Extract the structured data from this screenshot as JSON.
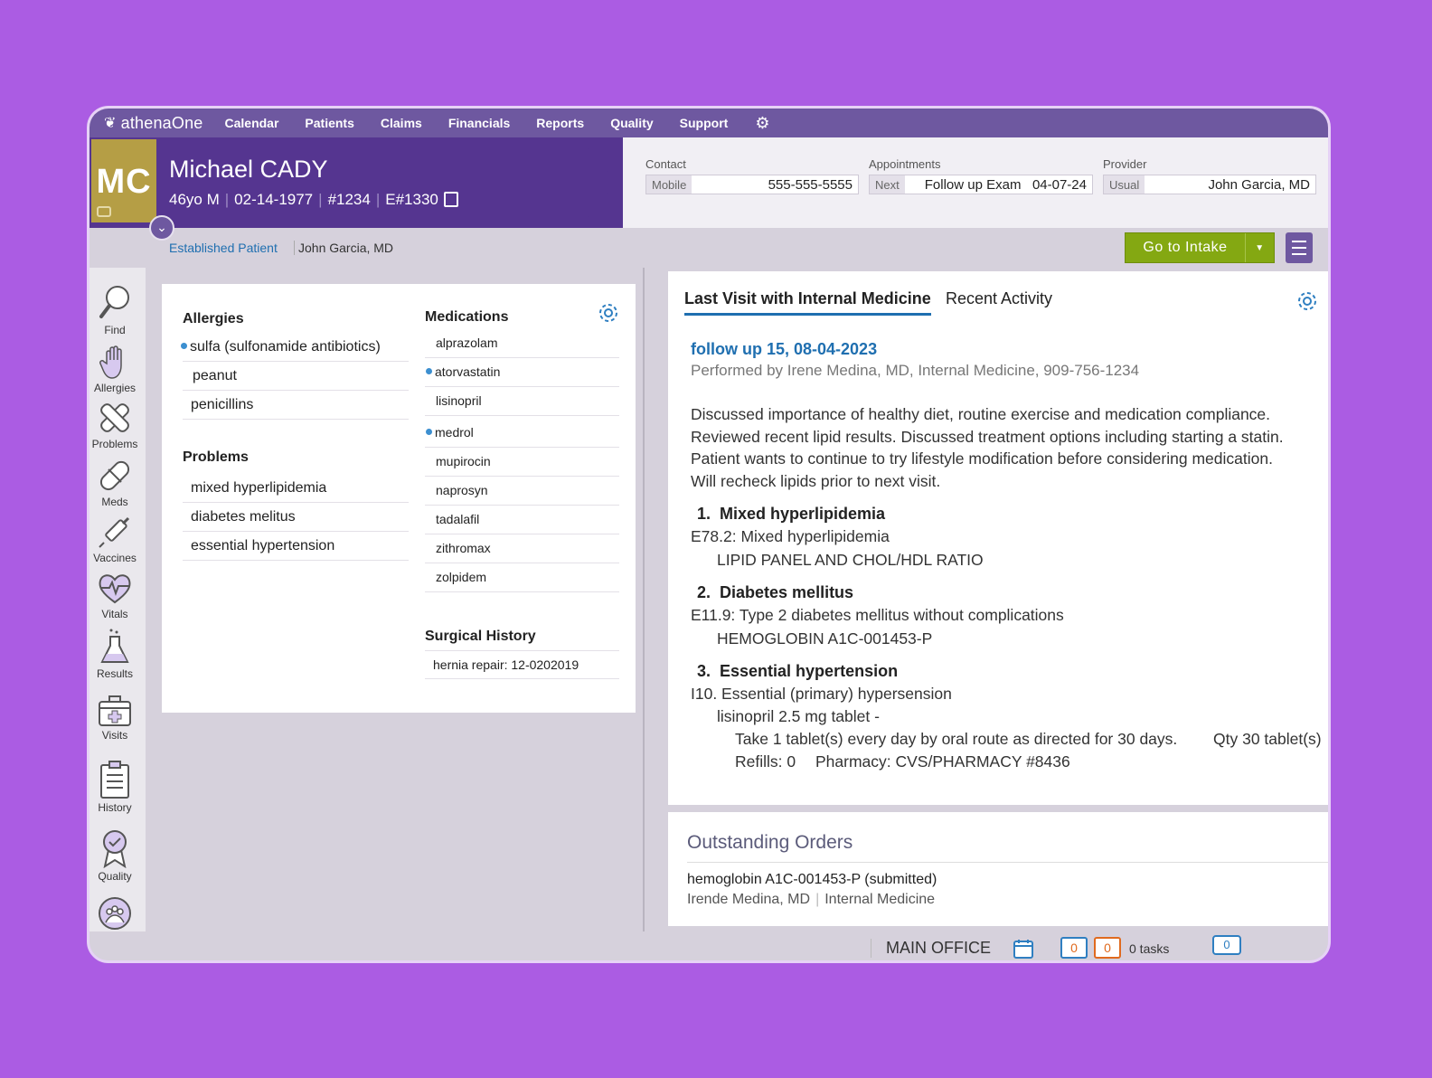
{
  "nav": {
    "logo": "athenaOne",
    "items": [
      "Calendar",
      "Patients",
      "Claims",
      "Financials",
      "Reports",
      "Quality",
      "Support"
    ]
  },
  "patient": {
    "initials": "MC",
    "name": "Michael CADY",
    "age_sex": "46yo M",
    "dob": "02-14-1977",
    "id": "#1234",
    "enc": "E#1330",
    "status": "Established Patient",
    "provider": "John Garcia, MD"
  },
  "header": {
    "contact": {
      "label": "Contact",
      "key": "Mobile",
      "value": "555-555-5555"
    },
    "appointments": {
      "label": "Appointments",
      "key": "Next",
      "value": "Follow up Exam   04-07-24"
    },
    "provider": {
      "label": "Provider",
      "key": "Usual",
      "value": "John Garcia, MD"
    },
    "intake_button": "Go to  Intake"
  },
  "sidebar": [
    {
      "label": "Find",
      "icon": "magnifier-icon"
    },
    {
      "label": "Allergies",
      "icon": "hand-icon"
    },
    {
      "label": "Problems",
      "icon": "bandage-cross-icon"
    },
    {
      "label": "Meds",
      "icon": "pill-icon"
    },
    {
      "label": "Vaccines",
      "icon": "syringe-icon"
    },
    {
      "label": "Vitals",
      "icon": "heartbeat-icon"
    },
    {
      "label": "Results",
      "icon": "flask-icon"
    },
    {
      "label": "Visits",
      "icon": "medkit-icon"
    },
    {
      "label": "History",
      "icon": "clipboard-icon"
    },
    {
      "label": "Quality",
      "icon": "ribbon-icon"
    }
  ],
  "summary": {
    "allergies_title": "Allergies",
    "allergies": [
      "sulfa (sulfonamide antibiotics)",
      "peanut",
      "penicillins"
    ],
    "problems_title": "Problems",
    "problems": [
      "mixed hyperlipidemia",
      "diabetes melitus",
      "essential hypertension"
    ],
    "medications_title": "Medications",
    "medications": [
      "alprazolam",
      "atorvastatin",
      "lisinopril",
      "medrol",
      "mupirocin",
      "naprosyn",
      "tadalafil",
      "zithromax",
      "zolpidem"
    ],
    "surgical_title": "Surgical History",
    "surgical": [
      "hernia repair: 12-0202019"
    ]
  },
  "visit": {
    "tab_active": "Last Visit with Internal Medicine",
    "tab_other": "Recent Activity",
    "title": "follow up 15, 08-04-2023",
    "performed": "Performed by Irene Medina, MD, Internal Medicine, 909-756-1234",
    "notes": [
      "Discussed importance of healthy diet, routine exercise and medication compliance.",
      "Reviewed recent lipid results.  Discussed treatment options including starting a statin.",
      "Patient wants to continue to try lifestyle modification before considering medication.",
      "Will recheck lipids prior to next visit."
    ],
    "dx1_title": "1.  Mixed hyperlipidemia",
    "dx1_code": "E78.2: Mixed hyperlipidemia",
    "dx1_order": "LIPID PANEL AND CHOL/HDL RATIO",
    "dx2_title": "2.  Diabetes mellitus",
    "dx2_code": "E11.9: Type 2 diabetes mellitus without complications",
    "dx2_order": "HEMOGLOBIN A1C-001453-P",
    "dx3_title": "3.  Essential hypertension",
    "dx3_code": "I10. Essential (primary) hypersension",
    "dx3_rx": "lisinopril 2.5 mg tablet -",
    "dx3_sig": "Take 1 tablet(s) every day by oral route as directed for 30 days.",
    "dx3_qty": "Qty 30 tablet(s)",
    "dx3_refills": "Refills: 0",
    "dx3_pharmacy": "Pharmacy: CVS/PHARMACY #8436"
  },
  "orders": {
    "title": "Outstanding Orders",
    "name": "hemoglobin  A1C-001453-P (submitted)",
    "provider": "Irende Medina, MD",
    "dept": "Internal Medicine"
  },
  "status": {
    "office": "MAIN OFFICE",
    "count1": "0",
    "count2": "0",
    "tasks": "0 tasks",
    "messages": "0"
  },
  "colors": {
    "nav": "#6e58a0",
    "banner": "#553590",
    "avatar": "#b59e45",
    "intake": "#84a812",
    "link": "#1f6fb0"
  }
}
